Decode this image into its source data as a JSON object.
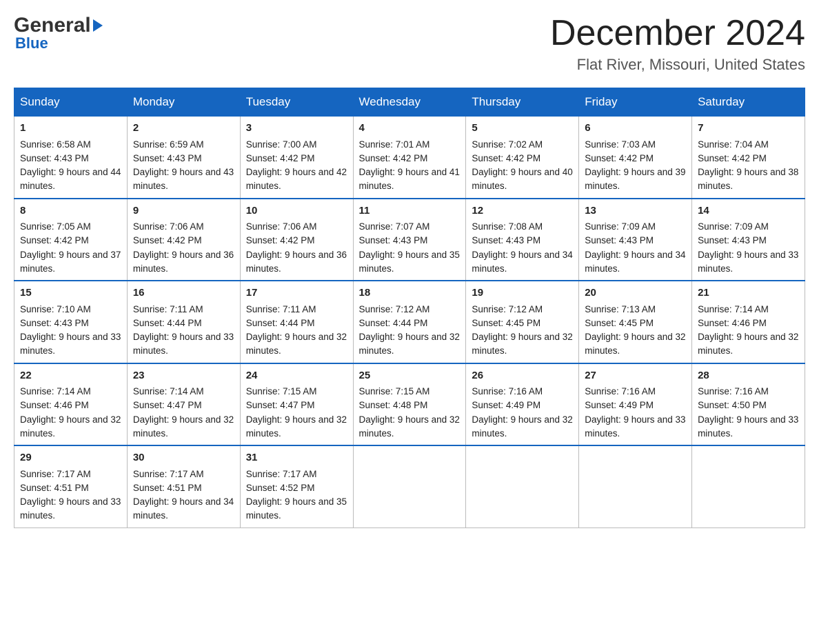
{
  "header": {
    "logo_line1": "General",
    "logo_line2": "Blue",
    "month_title": "December 2024",
    "location": "Flat River, Missouri, United States"
  },
  "days_of_week": [
    "Sunday",
    "Monday",
    "Tuesday",
    "Wednesday",
    "Thursday",
    "Friday",
    "Saturday"
  ],
  "weeks": [
    [
      {
        "day": 1,
        "sunrise": "6:58 AM",
        "sunset": "4:43 PM",
        "daylight": "9 hours and 44 minutes."
      },
      {
        "day": 2,
        "sunrise": "6:59 AM",
        "sunset": "4:43 PM",
        "daylight": "9 hours and 43 minutes."
      },
      {
        "day": 3,
        "sunrise": "7:00 AM",
        "sunset": "4:42 PM",
        "daylight": "9 hours and 42 minutes."
      },
      {
        "day": 4,
        "sunrise": "7:01 AM",
        "sunset": "4:42 PM",
        "daylight": "9 hours and 41 minutes."
      },
      {
        "day": 5,
        "sunrise": "7:02 AM",
        "sunset": "4:42 PM",
        "daylight": "9 hours and 40 minutes."
      },
      {
        "day": 6,
        "sunrise": "7:03 AM",
        "sunset": "4:42 PM",
        "daylight": "9 hours and 39 minutes."
      },
      {
        "day": 7,
        "sunrise": "7:04 AM",
        "sunset": "4:42 PM",
        "daylight": "9 hours and 38 minutes."
      }
    ],
    [
      {
        "day": 8,
        "sunrise": "7:05 AM",
        "sunset": "4:42 PM",
        "daylight": "9 hours and 37 minutes."
      },
      {
        "day": 9,
        "sunrise": "7:06 AM",
        "sunset": "4:42 PM",
        "daylight": "9 hours and 36 minutes."
      },
      {
        "day": 10,
        "sunrise": "7:06 AM",
        "sunset": "4:42 PM",
        "daylight": "9 hours and 36 minutes."
      },
      {
        "day": 11,
        "sunrise": "7:07 AM",
        "sunset": "4:43 PM",
        "daylight": "9 hours and 35 minutes."
      },
      {
        "day": 12,
        "sunrise": "7:08 AM",
        "sunset": "4:43 PM",
        "daylight": "9 hours and 34 minutes."
      },
      {
        "day": 13,
        "sunrise": "7:09 AM",
        "sunset": "4:43 PM",
        "daylight": "9 hours and 34 minutes."
      },
      {
        "day": 14,
        "sunrise": "7:09 AM",
        "sunset": "4:43 PM",
        "daylight": "9 hours and 33 minutes."
      }
    ],
    [
      {
        "day": 15,
        "sunrise": "7:10 AM",
        "sunset": "4:43 PM",
        "daylight": "9 hours and 33 minutes."
      },
      {
        "day": 16,
        "sunrise": "7:11 AM",
        "sunset": "4:44 PM",
        "daylight": "9 hours and 33 minutes."
      },
      {
        "day": 17,
        "sunrise": "7:11 AM",
        "sunset": "4:44 PM",
        "daylight": "9 hours and 32 minutes."
      },
      {
        "day": 18,
        "sunrise": "7:12 AM",
        "sunset": "4:44 PM",
        "daylight": "9 hours and 32 minutes."
      },
      {
        "day": 19,
        "sunrise": "7:12 AM",
        "sunset": "4:45 PM",
        "daylight": "9 hours and 32 minutes."
      },
      {
        "day": 20,
        "sunrise": "7:13 AM",
        "sunset": "4:45 PM",
        "daylight": "9 hours and 32 minutes."
      },
      {
        "day": 21,
        "sunrise": "7:14 AM",
        "sunset": "4:46 PM",
        "daylight": "9 hours and 32 minutes."
      }
    ],
    [
      {
        "day": 22,
        "sunrise": "7:14 AM",
        "sunset": "4:46 PM",
        "daylight": "9 hours and 32 minutes."
      },
      {
        "day": 23,
        "sunrise": "7:14 AM",
        "sunset": "4:47 PM",
        "daylight": "9 hours and 32 minutes."
      },
      {
        "day": 24,
        "sunrise": "7:15 AM",
        "sunset": "4:47 PM",
        "daylight": "9 hours and 32 minutes."
      },
      {
        "day": 25,
        "sunrise": "7:15 AM",
        "sunset": "4:48 PM",
        "daylight": "9 hours and 32 minutes."
      },
      {
        "day": 26,
        "sunrise": "7:16 AM",
        "sunset": "4:49 PM",
        "daylight": "9 hours and 32 minutes."
      },
      {
        "day": 27,
        "sunrise": "7:16 AM",
        "sunset": "4:49 PM",
        "daylight": "9 hours and 33 minutes."
      },
      {
        "day": 28,
        "sunrise": "7:16 AM",
        "sunset": "4:50 PM",
        "daylight": "9 hours and 33 minutes."
      }
    ],
    [
      {
        "day": 29,
        "sunrise": "7:17 AM",
        "sunset": "4:51 PM",
        "daylight": "9 hours and 33 minutes."
      },
      {
        "day": 30,
        "sunrise": "7:17 AM",
        "sunset": "4:51 PM",
        "daylight": "9 hours and 34 minutes."
      },
      {
        "day": 31,
        "sunrise": "7:17 AM",
        "sunset": "4:52 PM",
        "daylight": "9 hours and 35 minutes."
      },
      null,
      null,
      null,
      null
    ]
  ]
}
